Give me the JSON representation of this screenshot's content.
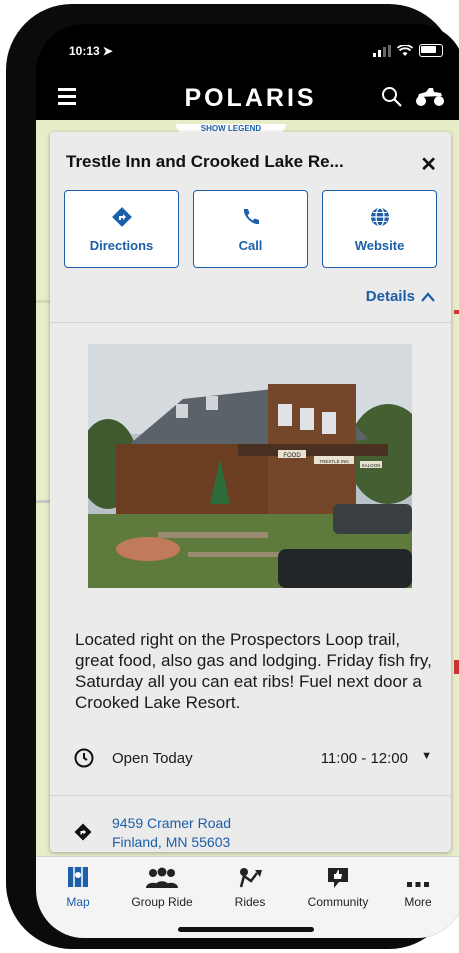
{
  "status_bar": {
    "time": "10:13",
    "location_arrow": "➤"
  },
  "header": {
    "brand": "POLARIS",
    "menu_icon": "hamburger-icon",
    "search_icon": "search-icon",
    "vehicle_icon": "atv-icon"
  },
  "map": {
    "legend_label": "SHOW LEGEND"
  },
  "card": {
    "title": "Trestle Inn and Crooked Lake Re...",
    "close": "✕",
    "actions": [
      {
        "label": "Directions",
        "icon": "directions-icon"
      },
      {
        "label": "Call",
        "icon": "phone-icon"
      },
      {
        "label": "Website",
        "icon": "globe-icon"
      }
    ],
    "details_label": "Details",
    "photo_signs": {
      "sign1": "FOOD",
      "sign2": "TRESTLE INN",
      "sign3": "SALOON"
    },
    "description": "Located right on the Prospectors Loop trail, great food, also gas and lodging. Friday fish fry, Saturday all you can eat ribs!  Fuel next door a Crooked Lake Resort.",
    "hours": {
      "label": "Open Today",
      "time": "11:00 - 12:00"
    },
    "address": {
      "line1": "9459 Cramer Road",
      "line2": "Finland, MN 55603"
    }
  },
  "tabs": [
    {
      "label": "Map",
      "icon": "map-icon",
      "active": true
    },
    {
      "label": "Group Ride",
      "icon": "group-icon",
      "active": false
    },
    {
      "label": "Rides",
      "icon": "rides-icon",
      "active": false
    },
    {
      "label": "Community",
      "icon": "community-icon",
      "active": false
    },
    {
      "label": "More",
      "icon": "more-icon",
      "active": false
    }
  ],
  "colors": {
    "accent": "#1c5fa8",
    "card_bg": "#ebebeb",
    "map_bg": "#e7ecc9"
  }
}
